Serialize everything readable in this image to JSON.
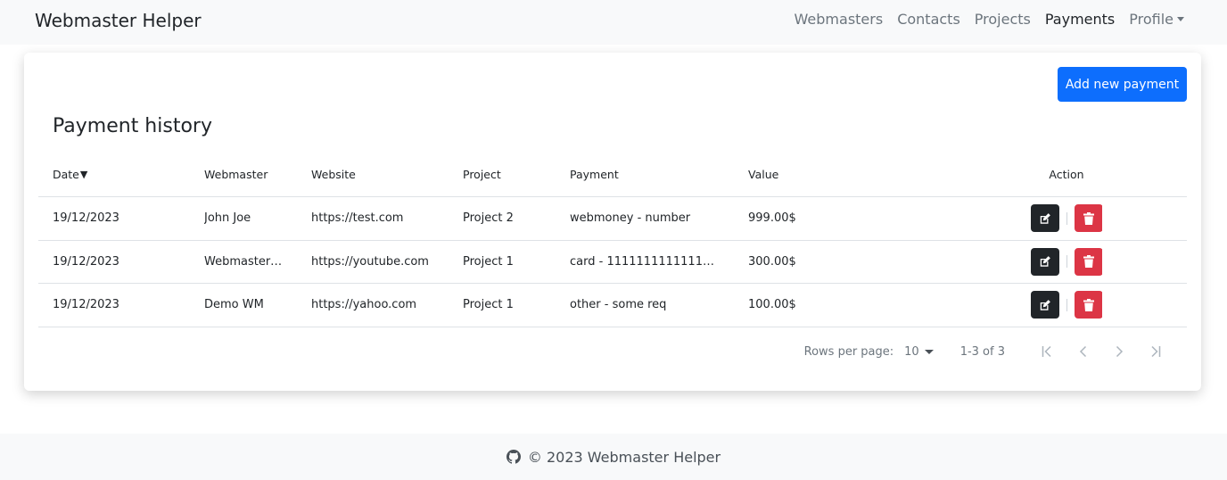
{
  "brand": "Webmaster Helper",
  "nav": {
    "items": [
      "Webmasters",
      "Contacts",
      "Projects",
      "Payments"
    ],
    "active": "Payments",
    "profile_label": "Profile"
  },
  "card": {
    "add_button": "Add new payment",
    "title": "Payment history"
  },
  "table": {
    "headers": {
      "date": "Date",
      "sort_indicator": "▼",
      "webmaster": "Webmaster",
      "website": "Website",
      "project": "Project",
      "payment": "Payment",
      "value": "Value",
      "action": "Action"
    },
    "rows": [
      {
        "date": "19/12/2023",
        "webmaster": "John Joe",
        "website": "https://test.com",
        "project": "Project 2",
        "payment": "webmoney - number",
        "value": "999.00$"
      },
      {
        "date": "19/12/2023",
        "webmaster": "Webmaster…",
        "website": "https://youtube.com",
        "project": "Project 1",
        "payment": "card - 1111111111111…",
        "value": "300.00$"
      },
      {
        "date": "19/12/2023",
        "webmaster": "Demo WM",
        "website": "https://yahoo.com",
        "project": "Project 1",
        "payment": "other - some req",
        "value": "100.00$"
      }
    ]
  },
  "pagination": {
    "rows_per_page_label": "Rows per page:",
    "rows_per_page_value": "10",
    "range": "1-3 of 3"
  },
  "footer": {
    "text": "© 2023 Webmaster Helper",
    "icon": "github-icon"
  },
  "colors": {
    "primary": "#0d6efd",
    "danger": "#dc3545",
    "dark": "#212529"
  }
}
